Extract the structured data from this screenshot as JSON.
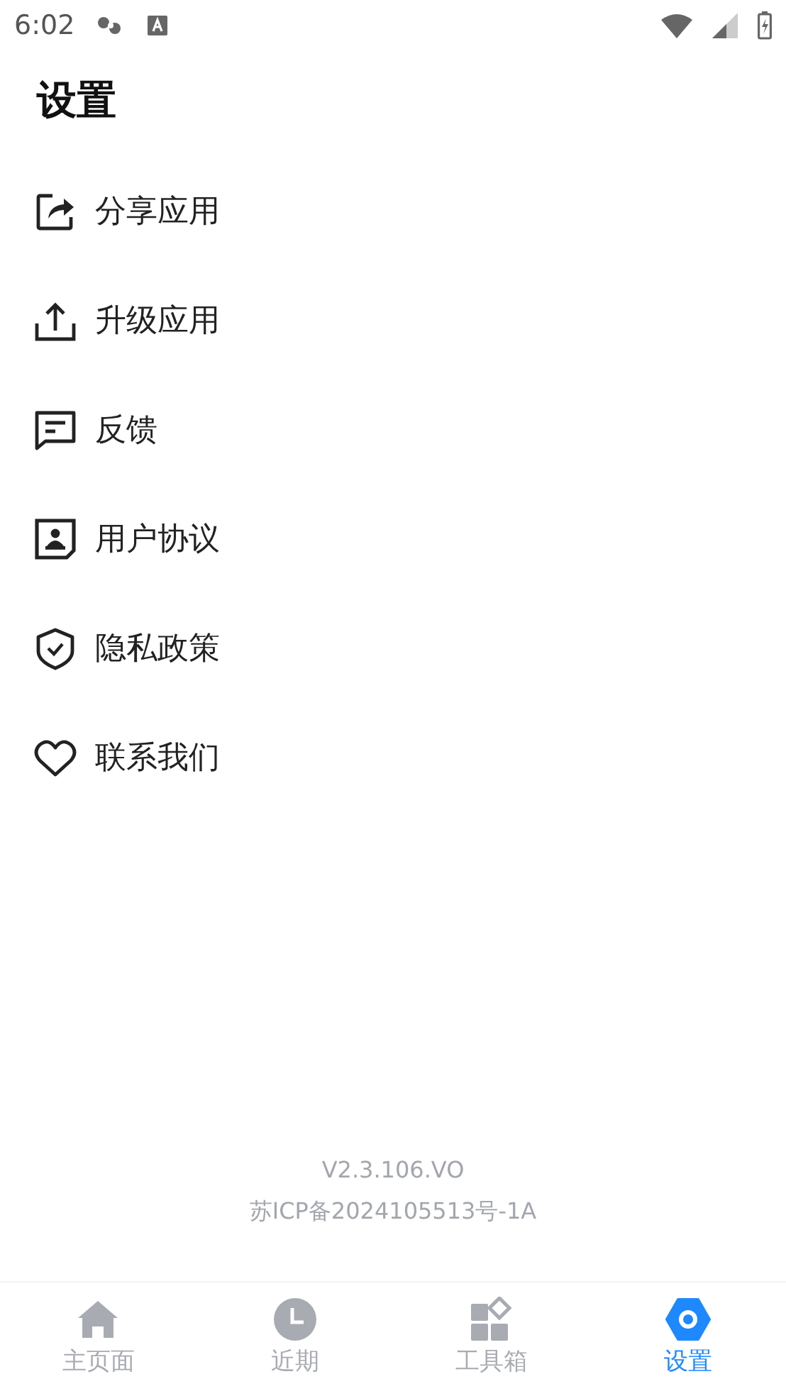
{
  "status_bar": {
    "time": "6:02"
  },
  "title": "设置",
  "menu": [
    {
      "label": "分享应用"
    },
    {
      "label": "升级应用"
    },
    {
      "label": "反馈"
    },
    {
      "label": "用户协议"
    },
    {
      "label": "隐私政策"
    },
    {
      "label": "联系我们"
    }
  ],
  "footer": {
    "version": "V2.3.106.VO",
    "icp": "苏ICP备2024105513号-1A"
  },
  "tabs": [
    {
      "label": "主页面",
      "selected": false
    },
    {
      "label": "近期",
      "selected": false
    },
    {
      "label": "工具箱",
      "selected": false
    },
    {
      "label": "设置",
      "selected": true
    }
  ]
}
